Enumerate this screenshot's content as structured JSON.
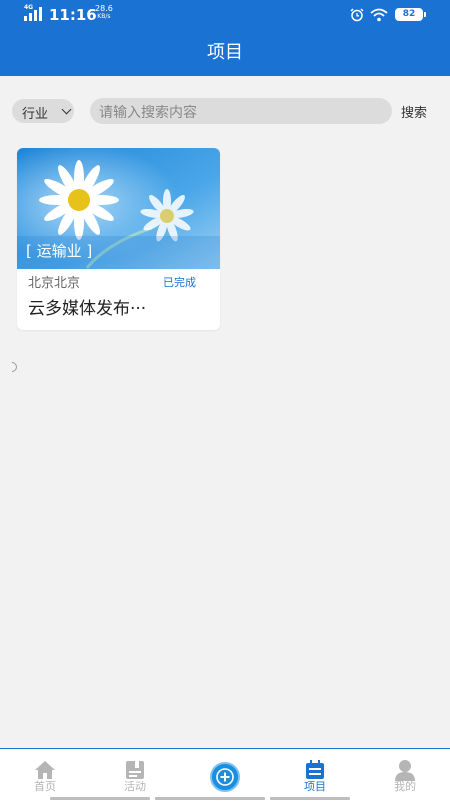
{
  "status_bar": {
    "network": "4G",
    "time": "11:16",
    "speed_value": "28.6",
    "speed_unit": "KB/s",
    "battery": "82"
  },
  "header": {
    "title": "项目"
  },
  "search": {
    "filter_label": "行业",
    "placeholder": "请输入搜索内容",
    "button": "搜索"
  },
  "projects": [
    {
      "tag": "[ 运输业 ]",
      "location": "北京北京",
      "status": "已完成",
      "name": "云多媒体发布···"
    }
  ],
  "tabs": [
    {
      "label": "首页",
      "icon": "home-icon"
    },
    {
      "label": "活动",
      "icon": "activity-icon"
    },
    {
      "label": "",
      "icon": "add-icon"
    },
    {
      "label": "项目",
      "icon": "calendar-icon",
      "active": true
    },
    {
      "label": "我的",
      "icon": "user-icon"
    }
  ],
  "colors": {
    "primary": "#1a73d2",
    "background": "#f2f2f2",
    "inactive": "#b5b5b5"
  }
}
